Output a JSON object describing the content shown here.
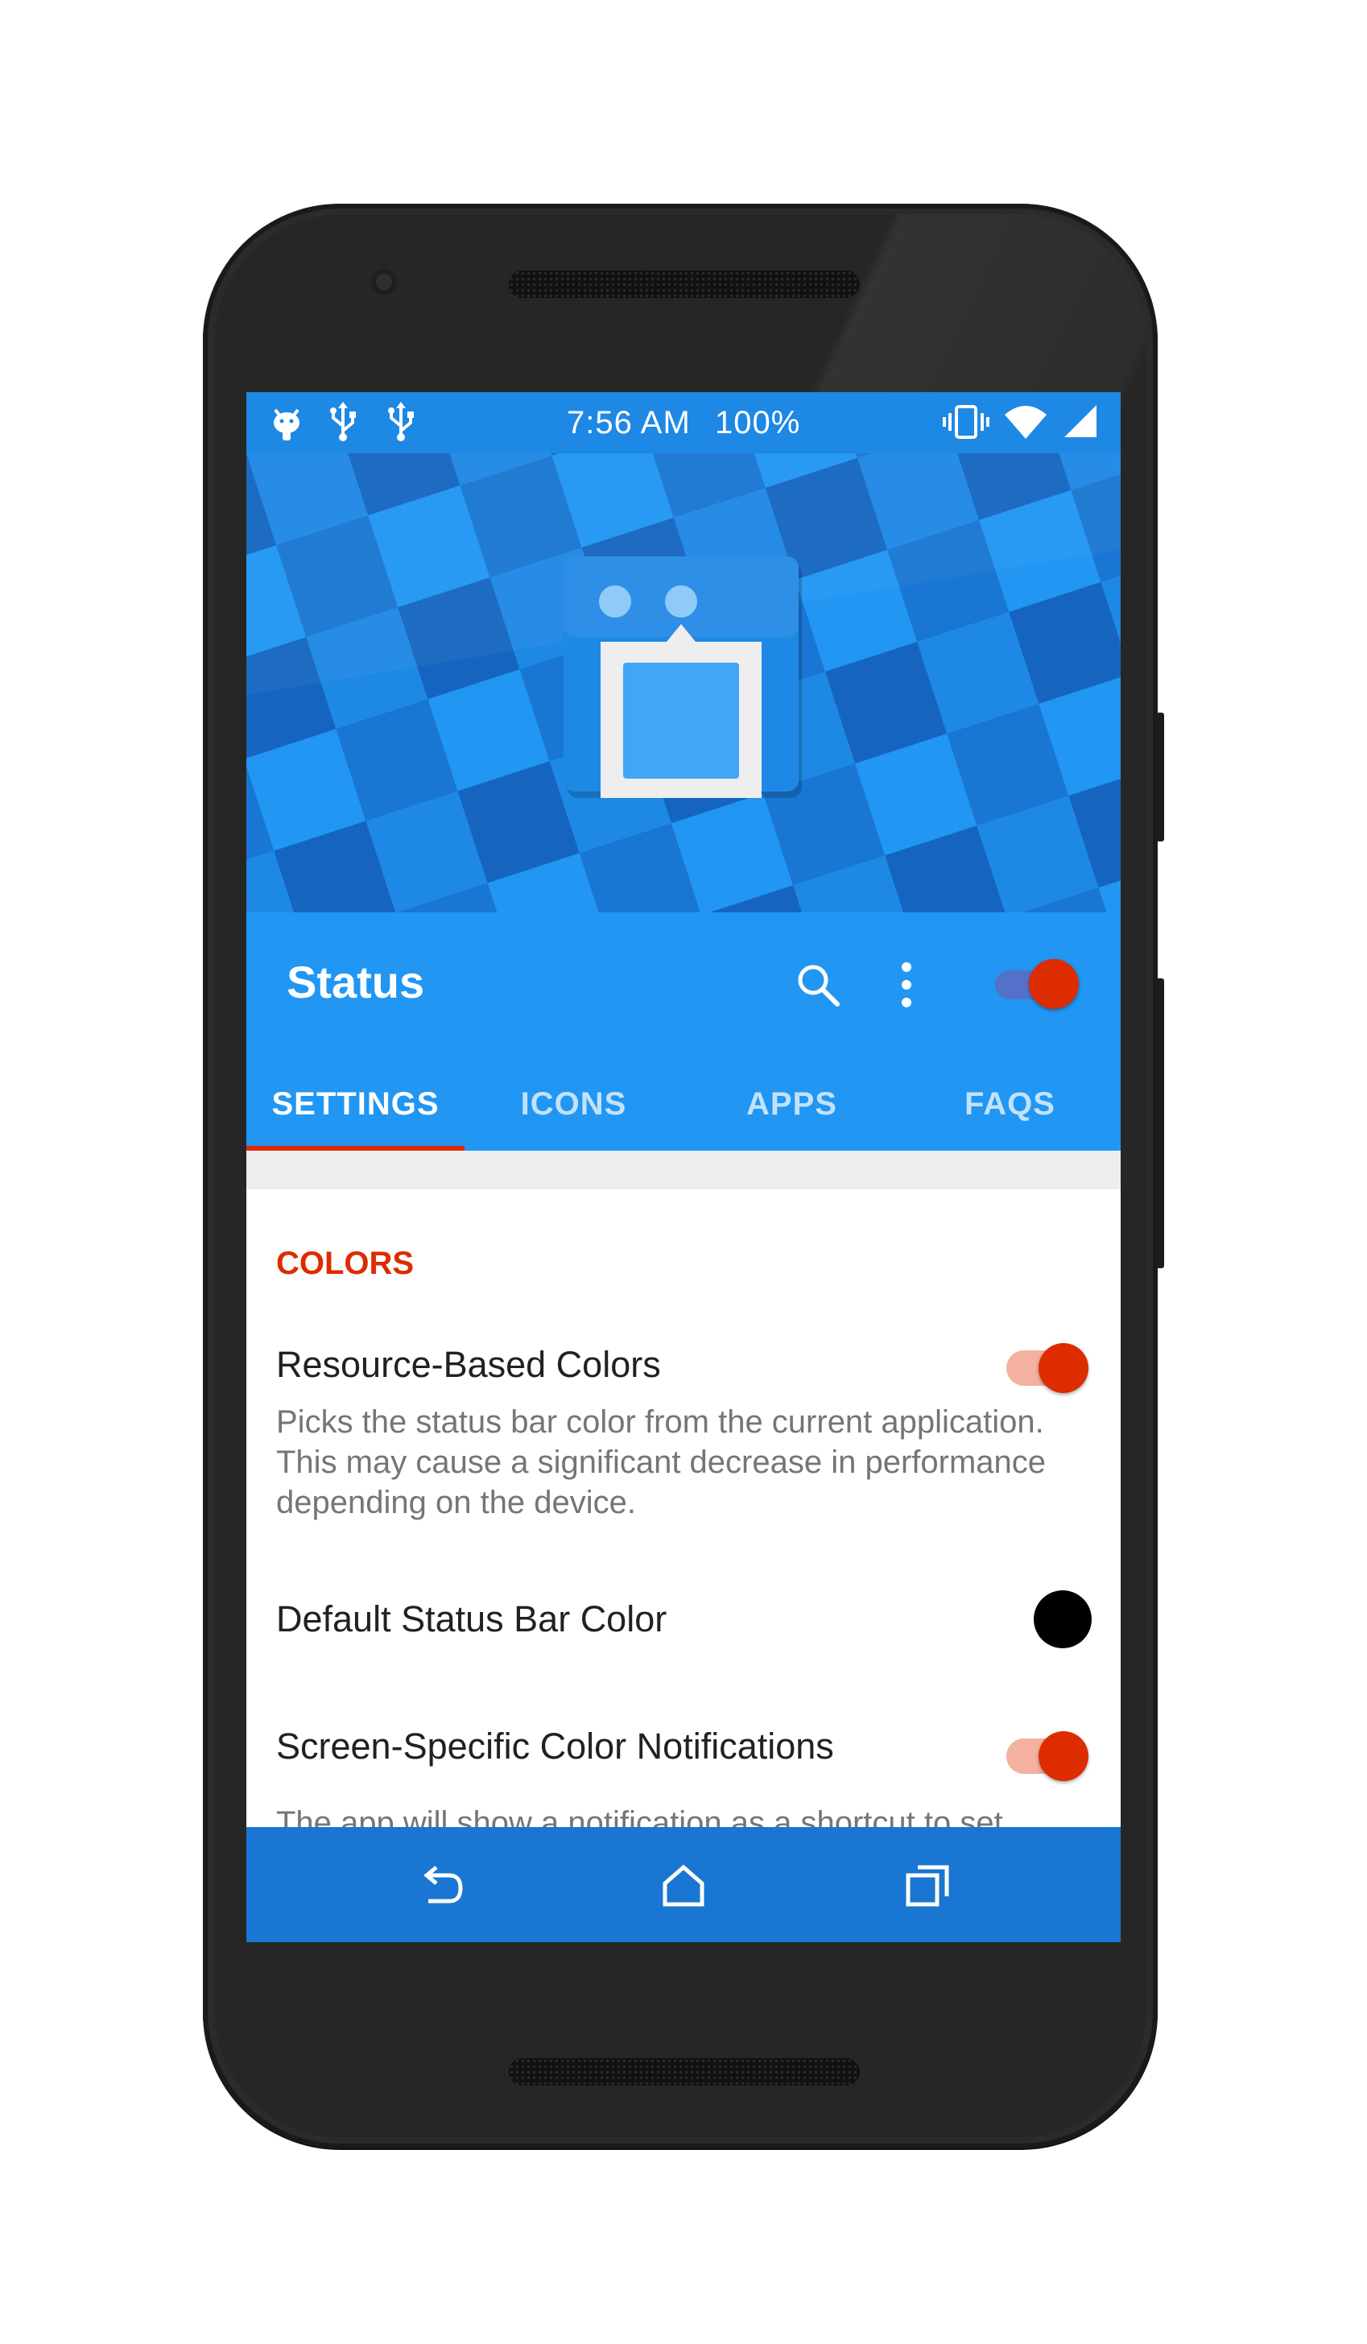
{
  "status_bar": {
    "time": "7:56 AM",
    "battery": "100%",
    "left_icons": [
      "android-debug-icon",
      "usb-icon",
      "usb-icon"
    ],
    "right_icons": [
      "vibrate-icon",
      "wifi-icon",
      "cell-signal-icon"
    ]
  },
  "app_bar": {
    "title": "Status",
    "actions": [
      "search-icon",
      "more-vert-icon"
    ],
    "master_switch_on": true
  },
  "tabs": [
    "SETTINGS",
    "ICONS",
    "APPS",
    "FAQS"
  ],
  "active_tab": "SETTINGS",
  "content": {
    "section_title": "COLORS",
    "prefs": [
      {
        "title": "Resource-Based Colors",
        "description": "Picks the status bar color from the current application. This may cause a significant decrease in performance depending on the device.",
        "control": "switch",
        "checked": true
      },
      {
        "title": "Default Status Bar Color",
        "control": "color-swatch",
        "color": "#000000"
      },
      {
        "title": "Screen-Specific Color Notifications",
        "description": "The app will show a notification as a shortcut to set",
        "control": "switch",
        "checked": true
      }
    ]
  },
  "nav_bar": [
    "back-icon",
    "home-icon",
    "recents-icon"
  ],
  "colors": {
    "primary": "#2196f3",
    "primary_dark": "#1976d2",
    "accent": "#dd2c00",
    "accent_light": "#f4b1a0"
  }
}
